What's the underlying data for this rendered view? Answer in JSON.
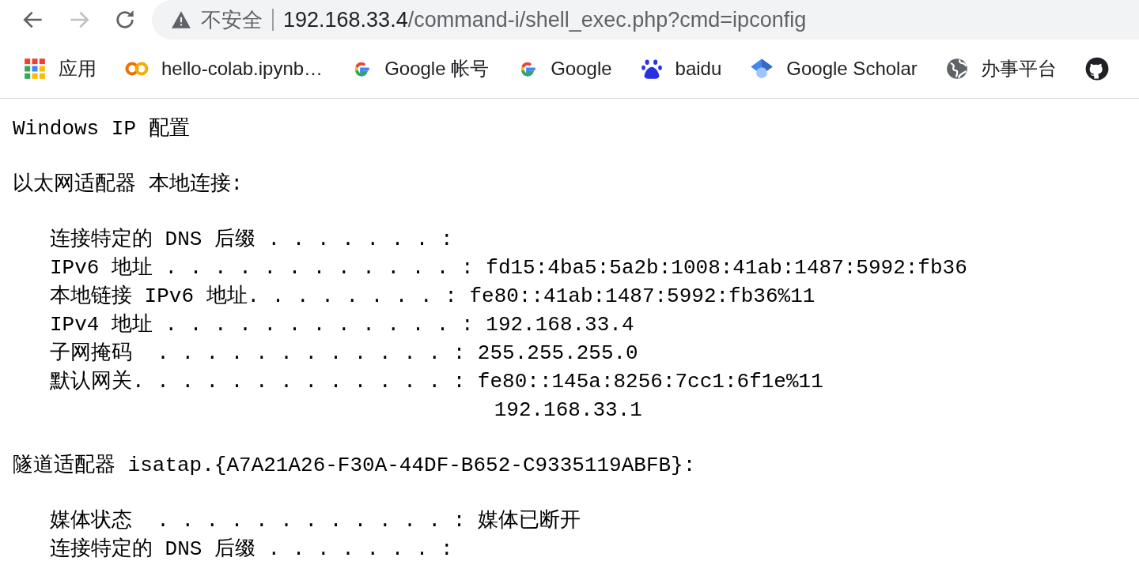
{
  "toolbar": {
    "security_label": "不安全",
    "url_host": "192.168.33.4",
    "url_path": "/command-i/shell_exec.php?cmd=ipconfig"
  },
  "bookmarks": [
    {
      "kind": "apps",
      "label": "应用"
    },
    {
      "kind": "colab",
      "label": "hello-colab.ipynb…"
    },
    {
      "kind": "google",
      "label": "Google 帐号"
    },
    {
      "kind": "google",
      "label": "Google"
    },
    {
      "kind": "baidu",
      "label": "baidu"
    },
    {
      "kind": "scholar",
      "label": "Google Scholar"
    },
    {
      "kind": "globe",
      "label": "办事平台"
    },
    {
      "kind": "github"
    }
  ],
  "output": [
    {
      "indented": false,
      "lines": [
        "Windows IP 配置"
      ]
    },
    {
      "indented": false,
      "lines": [
        "以太网适配器 本地连接:"
      ]
    },
    {
      "indented": true,
      "lines": [
        "连接特定的 DNS 后缀 . . . . . . . :",
        "IPv6 地址 . . . . . . . . . . . . : fd15:4ba5:5a2b:1008:41ab:1487:5992:fb36",
        "本地链接 IPv6 地址. . . . . . . . : fe80::41ab:1487:5992:fb36%11",
        "IPv4 地址 . . . . . . . . . . . . : 192.168.33.4",
        "子网掩码  . . . . . . . . . . . . : 255.255.255.0",
        "默认网关. . . . . . . . . . . . . : fe80::145a:8256:7cc1:6f1e%11",
        "                                    192.168.33.1"
      ]
    },
    {
      "indented": false,
      "lines": [
        "隧道适配器 isatap.{A7A21A26-F30A-44DF-B652-C9335119ABFB}:"
      ]
    },
    {
      "indented": true,
      "lines": [
        "媒体状态  . . . . . . . . . . . . : 媒体已断开",
        "连接特定的 DNS 后缀 . . . . . . . :"
      ]
    }
  ]
}
